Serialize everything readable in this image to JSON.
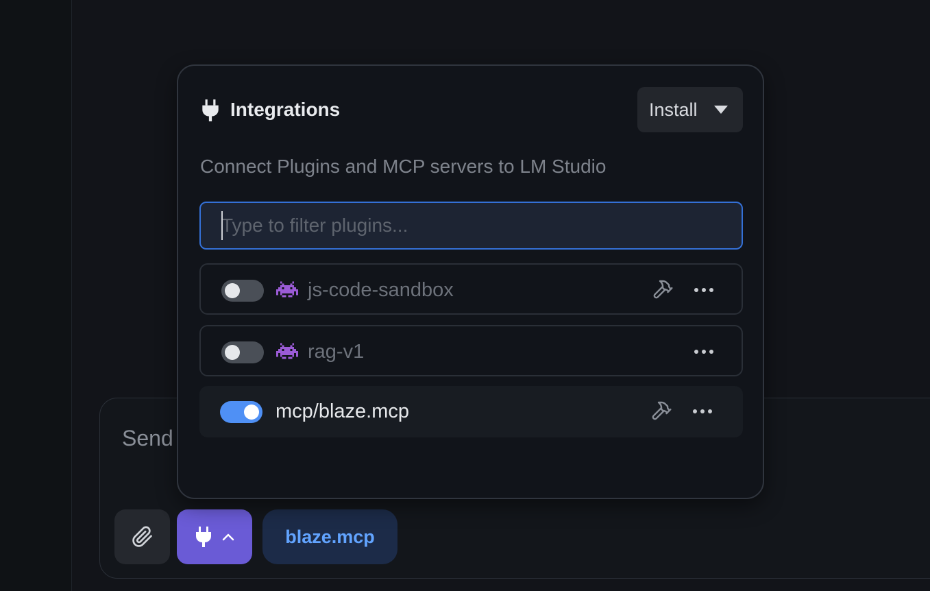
{
  "composer": {
    "placeholder": "Send",
    "chip_label": "blaze.mcp"
  },
  "popover": {
    "title": "Integrations",
    "install_label": "Install",
    "subtitle": "Connect Plugins and MCP servers to LM Studio",
    "filter_placeholder": "Type to filter plugins...",
    "plugins": [
      {
        "name": "js-code-sandbox",
        "enabled": false,
        "icon": "space-invader-icon",
        "has_tools": true
      },
      {
        "name": "rag-v1",
        "enabled": false,
        "icon": "space-invader-icon",
        "has_tools": false
      },
      {
        "name": "mcp/blaze.mcp",
        "enabled": true,
        "icon": "",
        "has_tools": true
      }
    ]
  },
  "colors": {
    "accent_purple": "#6a5bd6",
    "toggle_on": "#4f90f5",
    "focus_border": "#3470d6",
    "chip_text": "#62a4ff"
  }
}
